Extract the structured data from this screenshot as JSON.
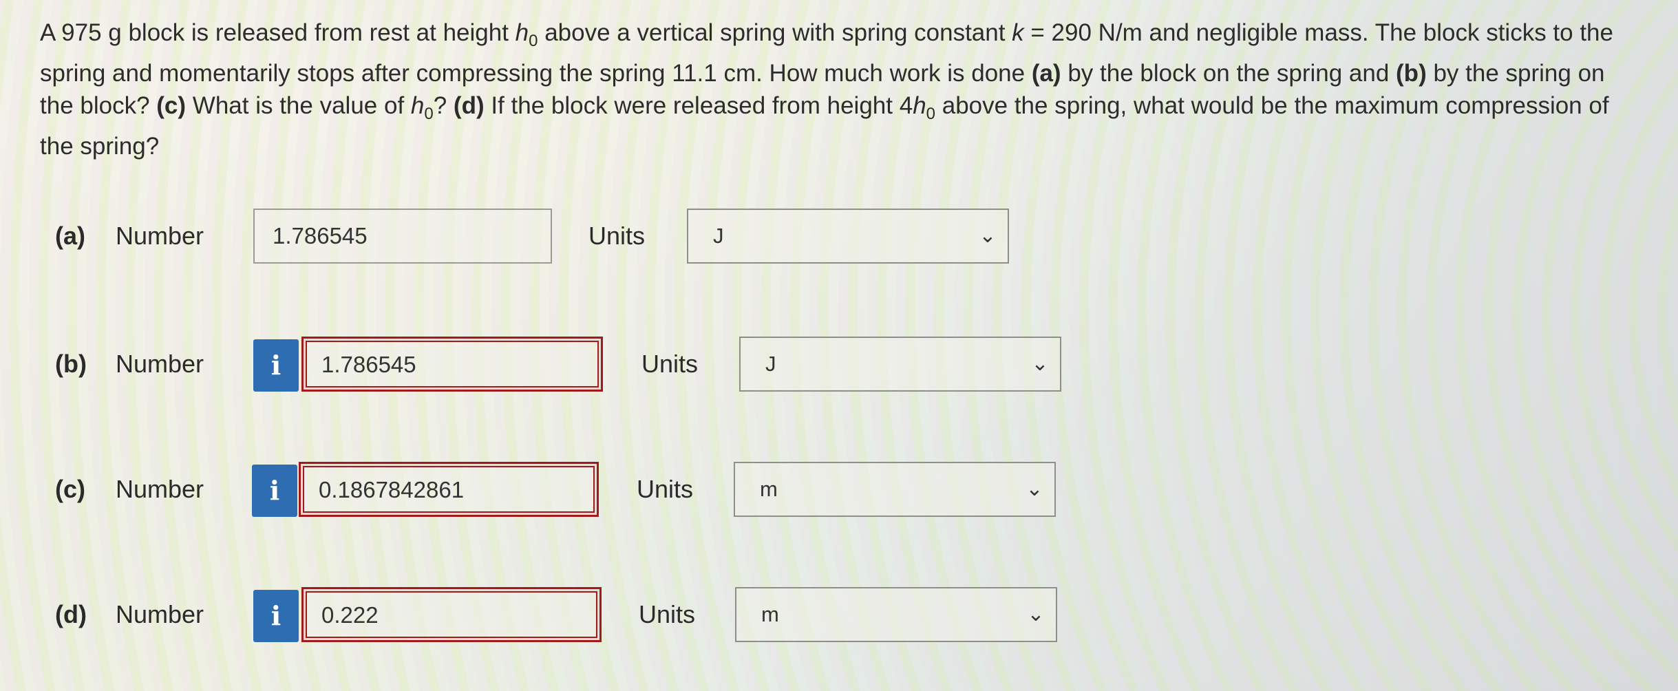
{
  "question": {
    "p1": "A 975 g block is released from rest at height ",
    "h0": "h",
    "h0_sub": "0",
    "p2": " above a vertical spring with spring constant ",
    "k": "k",
    "p3": " = 290 N/m and negligible mass. The block sticks to the spring and momentarily stops after compressing the spring 11.1 cm. How much work is done ",
    "a": "(a)",
    "p4": " by the block on the spring and ",
    "b": "(b)",
    "p5": " by the spring on the block? ",
    "c": "(c)",
    "p6": " What is the value of ",
    "p7": "? ",
    "d": "(d)",
    "p8": " If the block were released from height 4",
    "p9": " above the spring, what would be the maximum compression of the spring?"
  },
  "info_glyph": "i",
  "number_label": "Number",
  "units_label": "Units",
  "chevron": "⌄",
  "answers": [
    {
      "part": "(a)",
      "value": "1.786545",
      "unit": "J"
    },
    {
      "part": "(b)",
      "value": "1.786545",
      "unit": "J"
    },
    {
      "part": "(c)",
      "value": "0.1867842861",
      "unit": "m"
    },
    {
      "part": "(d)",
      "value": "0.222",
      "unit": "m"
    }
  ],
  "colors": {
    "info_button": "#2f6db3",
    "incorrect_border": "#a01c1c"
  }
}
